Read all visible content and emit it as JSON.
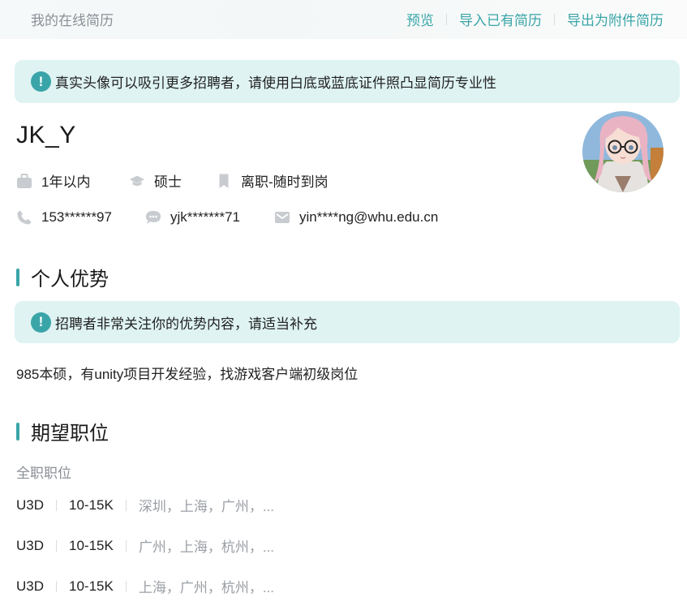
{
  "topbar": {
    "title": "我的在线简历",
    "actions": [
      "预览",
      "导入已有简历",
      "导出为附件简历"
    ]
  },
  "notices": {
    "avatar_tip": "真实头像可以吸引更多招聘者，请使用白底或蓝底证件照凸显简历专业性",
    "advantage_tip": "招聘者非常关注你的优势内容，请适当补充"
  },
  "profile": {
    "name": "JK_Y",
    "experience": "1年以内",
    "degree": "硕士",
    "status": "离职-随时到岗",
    "phone": "153******97",
    "wechat": "yjk*******71",
    "email": "yin****ng@whu.edu.cn"
  },
  "advantage": {
    "title": "个人优势",
    "text": "985本硕，有unity项目开发经验，找游戏客户端初级岗位"
  },
  "expectations": {
    "title": "期望职位",
    "job_type": "全职职位",
    "items": [
      {
        "position": "U3D",
        "salary": "10-15K",
        "cities": "深圳，上海，广州，..."
      },
      {
        "position": "U3D",
        "salary": "10-15K",
        "cities": "广州，上海，杭州，..."
      },
      {
        "position": "U3D",
        "salary": "10-15K",
        "cities": "上海，广州，杭州，..."
      }
    ]
  },
  "colors": {
    "accent": "#3aa5a8",
    "notice_bg": "#dff3f3",
    "icon_gray": "#c8ccd0",
    "muted_text": "#8a8f96"
  },
  "icons": {
    "notice": "exclamation-circle-icon",
    "experience": "briefcase-icon",
    "degree": "graduation-cap-icon",
    "status": "bookmark-icon",
    "phone": "phone-icon",
    "wechat": "chat-bubble-icon",
    "email": "envelope-icon"
  }
}
